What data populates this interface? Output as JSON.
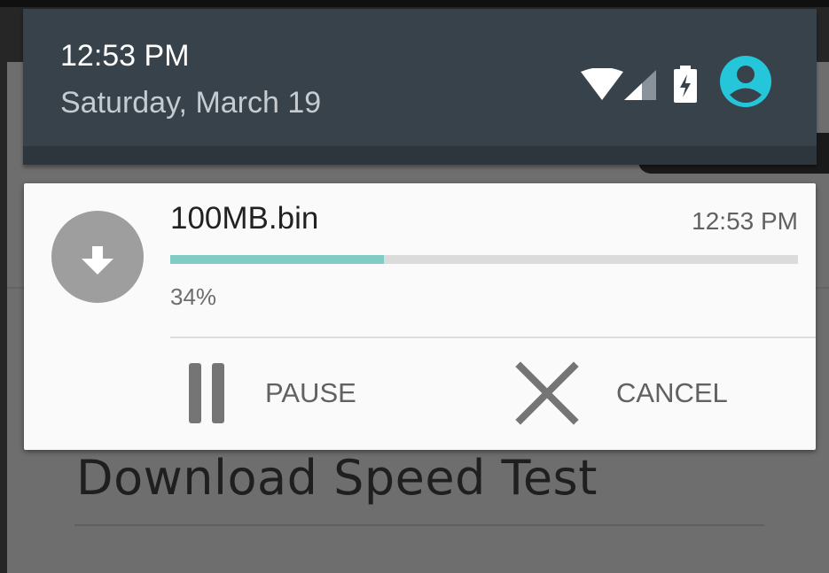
{
  "status_bar": {
    "time": "12:53 PM",
    "date": "Saturday, March 19",
    "icons": [
      "wifi-icon",
      "cellular-signal-icon",
      "battery-charging-icon",
      "user-avatar-icon"
    ],
    "avatar_color": "#26c6da"
  },
  "notification": {
    "file_name": "100MB.bin",
    "time": "12:53 PM",
    "progress_percent": 34,
    "progress_label": "34%",
    "progress_color": "#80cbc4",
    "icon": "download-icon",
    "actions": [
      {
        "label": "PAUSE",
        "icon": "pause-icon"
      },
      {
        "label": "CANCEL",
        "icon": "close-icon"
      }
    ]
  },
  "background_app": {
    "title": "Download Speed Test"
  }
}
